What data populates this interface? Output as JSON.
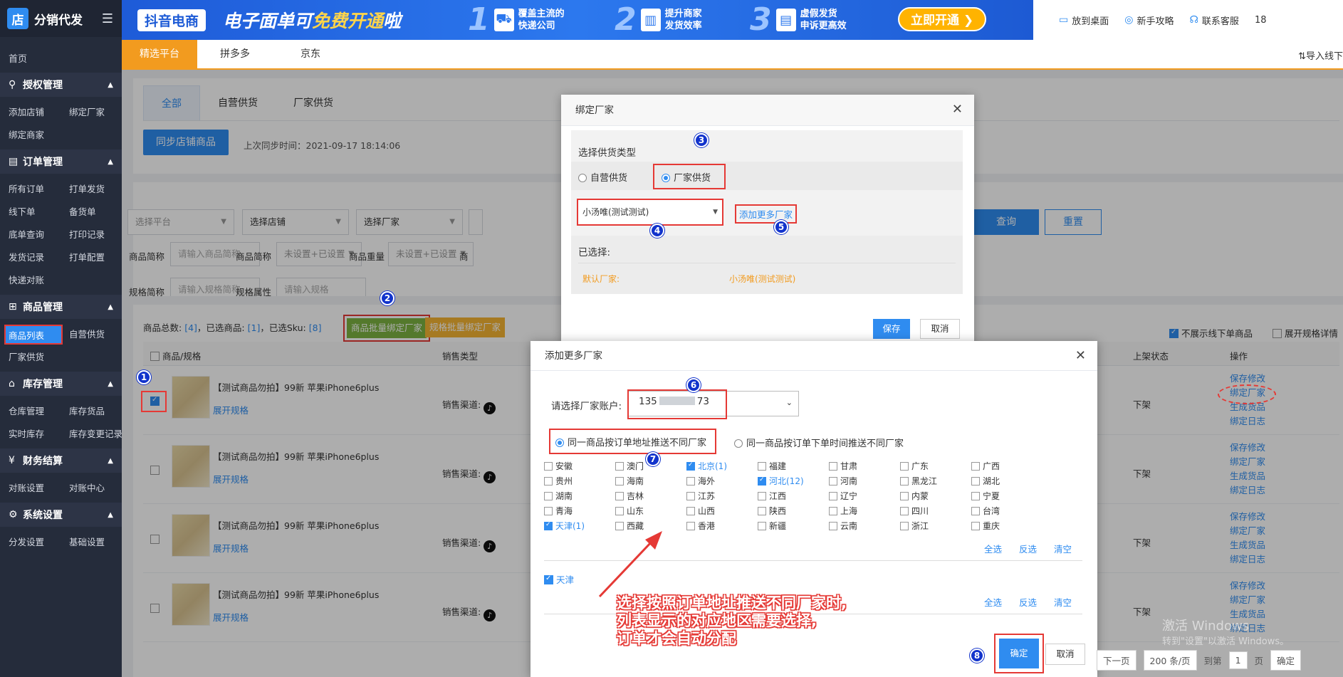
{
  "sidebar": {
    "logo_char": "店",
    "app_title": "分销代发",
    "home": "首页",
    "groups": [
      {
        "icon": "person-key-icon",
        "title": "授权管理",
        "items": [
          "添加店铺",
          "绑定厂家",
          "绑定商家"
        ]
      },
      {
        "icon": "clipboard-icon",
        "title": "订单管理",
        "items": [
          "所有订单",
          "打单发货",
          "线下单",
          "备货单",
          "底单查询",
          "打印记录",
          "发货记录",
          "打单配置",
          "快递对账"
        ]
      },
      {
        "icon": "grid-icon",
        "title": "商品管理",
        "items": [
          "商品列表",
          "自营供货",
          "厂家供货"
        ]
      },
      {
        "icon": "warehouse-icon",
        "title": "库存管理",
        "items": [
          "仓库管理",
          "库存货品",
          "实时库存",
          "库存变更记录"
        ]
      },
      {
        "icon": "yen-icon",
        "title": "财务结算",
        "items": [
          "对账设置",
          "对账中心"
        ]
      },
      {
        "icon": "gear-icon",
        "title": "系统设置",
        "items": [
          "分发设置",
          "基础设置"
        ]
      }
    ]
  },
  "banner": {
    "tag": "抖音电商",
    "headline_a": "电子面单可",
    "headline_em": "免费开通",
    "headline_b": "啦",
    "features": [
      {
        "num": "1",
        "text1": "覆盖主流的",
        "text2": "快递公司"
      },
      {
        "num": "2",
        "text1": "提升商家",
        "text2": "发货效率"
      },
      {
        "num": "3",
        "text1": "虚假发货",
        "text2": "申诉更高效"
      }
    ],
    "cta": "立即开通"
  },
  "toplinks": {
    "desktop": "放到桌面",
    "guide": "新手攻略",
    "service": "联系客服",
    "user": "18"
  },
  "platform_tabs": [
    "精选平台",
    "拼多多",
    "京东"
  ],
  "import_link": "导入线下",
  "supply_tabs": [
    "全部",
    "自营供货",
    "厂家供货"
  ],
  "sync": {
    "button": "同步店铺商品",
    "time": "上次同步时间：2021-09-17 18:14:06"
  },
  "filters": {
    "platform_ph": "选择平台",
    "shop_ph": "选择店铺",
    "factory_ph": "选择厂家",
    "name_label": "商品简称",
    "name_ph": "请输入商品简称",
    "name2_label": "商品简称",
    "name2_value": "未设置+已设置",
    "weight_label": "商品重量",
    "weight_value": "未设置+已设置",
    "label4": "商",
    "spec_label": "规格简称",
    "spec_ph": "请输入规格简称",
    "attr_label": "规格属性",
    "attr_ph": "请输入规格",
    "query": "查询",
    "reset": "重置"
  },
  "list": {
    "stats_a": "商品总数:",
    "stats_total": "[4]",
    "stats_b": "，已选商品:",
    "stats_sel": "[1]",
    "stats_c": "，已选Sku:",
    "stats_sku": "[8]",
    "bind_batch": "商品批量绑定厂家",
    "spec_batch": "规格批量绑定厂家",
    "opt_hide": "不展示线下单商品",
    "opt_expand": "展开规格详情",
    "headers": {
      "product": "商品/规格",
      "type": "销售类型",
      "status": "上架状态",
      "ops": "操作"
    },
    "rows": [
      {
        "name": "【测试商品勿拍】99新 苹果iPhone6plus",
        "expand": "展开规格",
        "channel": "销售渠道:",
        "status": "下架",
        "ops": [
          "保存修改",
          "绑定厂家",
          "生成货品",
          "绑定日志"
        ],
        "checked": true
      },
      {
        "name": "【测试商品勿拍】99新 苹果iPhone6plus",
        "expand": "展开规格",
        "channel": "销售渠道:",
        "status": "下架",
        "ops": [
          "保存修改",
          "绑定厂家",
          "生成货品",
          "绑定日志"
        ],
        "checked": false
      },
      {
        "name": "【测试商品勿拍】99新 苹果iPhone6plus",
        "expand": "展开规格",
        "channel": "销售渠道:",
        "status": "下架",
        "ops": [
          "保存修改",
          "绑定厂家",
          "生成货品",
          "绑定日志"
        ],
        "checked": false
      },
      {
        "name": "【测试商品勿拍】99新 苹果iPhone6plus",
        "expand": "展开规格",
        "channel": "销售渠道:",
        "status": "下架",
        "ops": [
          "保存修改",
          "绑定厂家",
          "生成货品",
          "绑定日志"
        ],
        "checked": false
      }
    ],
    "tiktok_glyph": "♪"
  },
  "bind_modal": {
    "title": "绑定厂家",
    "section_label": "选择供货类型",
    "radio_self": "自营供货",
    "radio_factory": "厂家供货",
    "factory_select": "小汤唯(测试测试)",
    "add_more": "添加更多厂家",
    "selected_label": "已选择:",
    "default_label": "默认厂家:",
    "default_value": "小汤唯(测试测试)",
    "save": "保存",
    "cancel": "取消"
  },
  "add_modal": {
    "title": "添加更多厂家",
    "account_label": "请选择厂家账户:",
    "account_prefix": "135",
    "account_suffix": "73",
    "radio_addr": "同一商品按订单地址推送不同厂家",
    "radio_time": "同一商品按订单下单时间推送不同厂家",
    "regions": [
      {
        "name": "安徽",
        "on": false
      },
      {
        "name": "澳门",
        "on": false
      },
      {
        "name": "北京(1)",
        "on": true
      },
      {
        "name": "福建",
        "on": false
      },
      {
        "name": "甘肃",
        "on": false
      },
      {
        "name": "广东",
        "on": false
      },
      {
        "name": "广西",
        "on": false
      },
      {
        "name": "贵州",
        "on": false
      },
      {
        "name": "海南",
        "on": false
      },
      {
        "name": "海外",
        "on": false
      },
      {
        "name": "河北(12)",
        "on": true
      },
      {
        "name": "河南",
        "on": false
      },
      {
        "name": "黑龙江",
        "on": false
      },
      {
        "name": "湖北",
        "on": false
      },
      {
        "name": "湖南",
        "on": false
      },
      {
        "name": "吉林",
        "on": false
      },
      {
        "name": "江苏",
        "on": false
      },
      {
        "name": "江西",
        "on": false
      },
      {
        "name": "辽宁",
        "on": false
      },
      {
        "name": "内蒙",
        "on": false
      },
      {
        "name": "宁夏",
        "on": false
      },
      {
        "name": "青海",
        "on": false
      },
      {
        "name": "山东",
        "on": false
      },
      {
        "name": "山西",
        "on": false
      },
      {
        "name": "陕西",
        "on": false
      },
      {
        "name": "上海",
        "on": false
      },
      {
        "name": "四川",
        "on": false
      },
      {
        "name": "台湾",
        "on": false
      },
      {
        "name": "天津(1)",
        "on": true
      },
      {
        "name": "西藏",
        "on": false
      },
      {
        "name": "香港",
        "on": false
      },
      {
        "name": "新疆",
        "on": false
      },
      {
        "name": "云南",
        "on": false
      },
      {
        "name": "浙江",
        "on": false
      },
      {
        "name": "重庆",
        "on": false
      }
    ],
    "select_all": "全选",
    "invert": "反选",
    "clear": "清空",
    "selected_region": "天津",
    "ok": "确定",
    "cancel": "取消"
  },
  "annotations": {
    "badges": [
      "1",
      "2",
      "3",
      "4",
      "5",
      "6",
      "7",
      "8"
    ],
    "callout_1": "选择按照订单地址推送不同厂家时,",
    "callout_2": "列表显示的对应地区需要选择,",
    "callout_3": "订单才会自动分配"
  },
  "watermark": {
    "line1": "激活 Windows",
    "line2": "转到\"设置\"以激活 Windows。"
  },
  "pager": {
    "prev": "下一页",
    "size": "200 条/页",
    "goto": "到第",
    "page": "1",
    "page_unit": "页",
    "confirm": "确定"
  },
  "colors": {
    "accent": "#2f8cf0",
    "orange": "#f29b1f",
    "annotation_red": "#e53935",
    "sidebar": "#252c3b"
  }
}
